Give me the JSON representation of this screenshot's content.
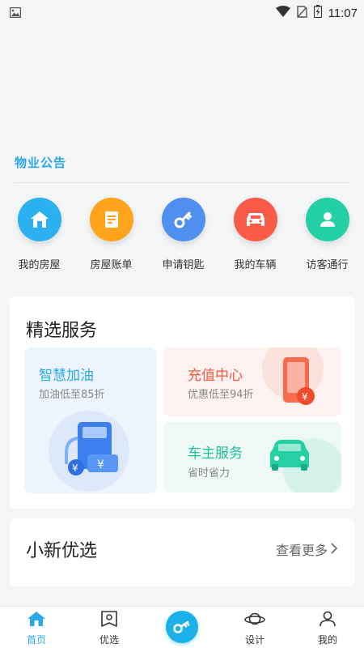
{
  "status_bar": {
    "time": "11:07"
  },
  "notice": {
    "label": "物业公告"
  },
  "quick_menu": [
    {
      "label": "我的房屋",
      "icon": "home-icon",
      "color": "#2bb0f0"
    },
    {
      "label": "房屋账单",
      "icon": "bill-icon",
      "color": "#ffa41c"
    },
    {
      "label": "申请钥匙",
      "icon": "key-icon",
      "color": "#4e8ff0"
    },
    {
      "label": "我的车辆",
      "icon": "car-icon",
      "color": "#fa5a48"
    },
    {
      "label": "访客通行",
      "icon": "visitor-icon",
      "color": "#23cfa4"
    }
  ],
  "featured": {
    "title": "精选服务",
    "fuel": {
      "title": "智慧加油",
      "subtitle": "加油低至85折",
      "color": "#2ba8e6"
    },
    "recharge": {
      "title": "充值中心",
      "subtitle": "优惠低至94折",
      "color": "#f25a3d"
    },
    "car_service": {
      "title": "车主服务",
      "subtitle": "省时省力",
      "color": "#1fbf9a"
    }
  },
  "selection": {
    "title": "小新优选",
    "more": "查看更多"
  },
  "tabs": [
    {
      "label": "首页",
      "icon": "home-icon",
      "active": true
    },
    {
      "label": "优选",
      "icon": "store-icon",
      "active": false
    },
    {
      "label": "",
      "icon": "key-icon",
      "active": false
    },
    {
      "label": "设计",
      "icon": "planet-icon",
      "active": false
    },
    {
      "label": "我的",
      "icon": "user-icon",
      "active": false
    }
  ]
}
